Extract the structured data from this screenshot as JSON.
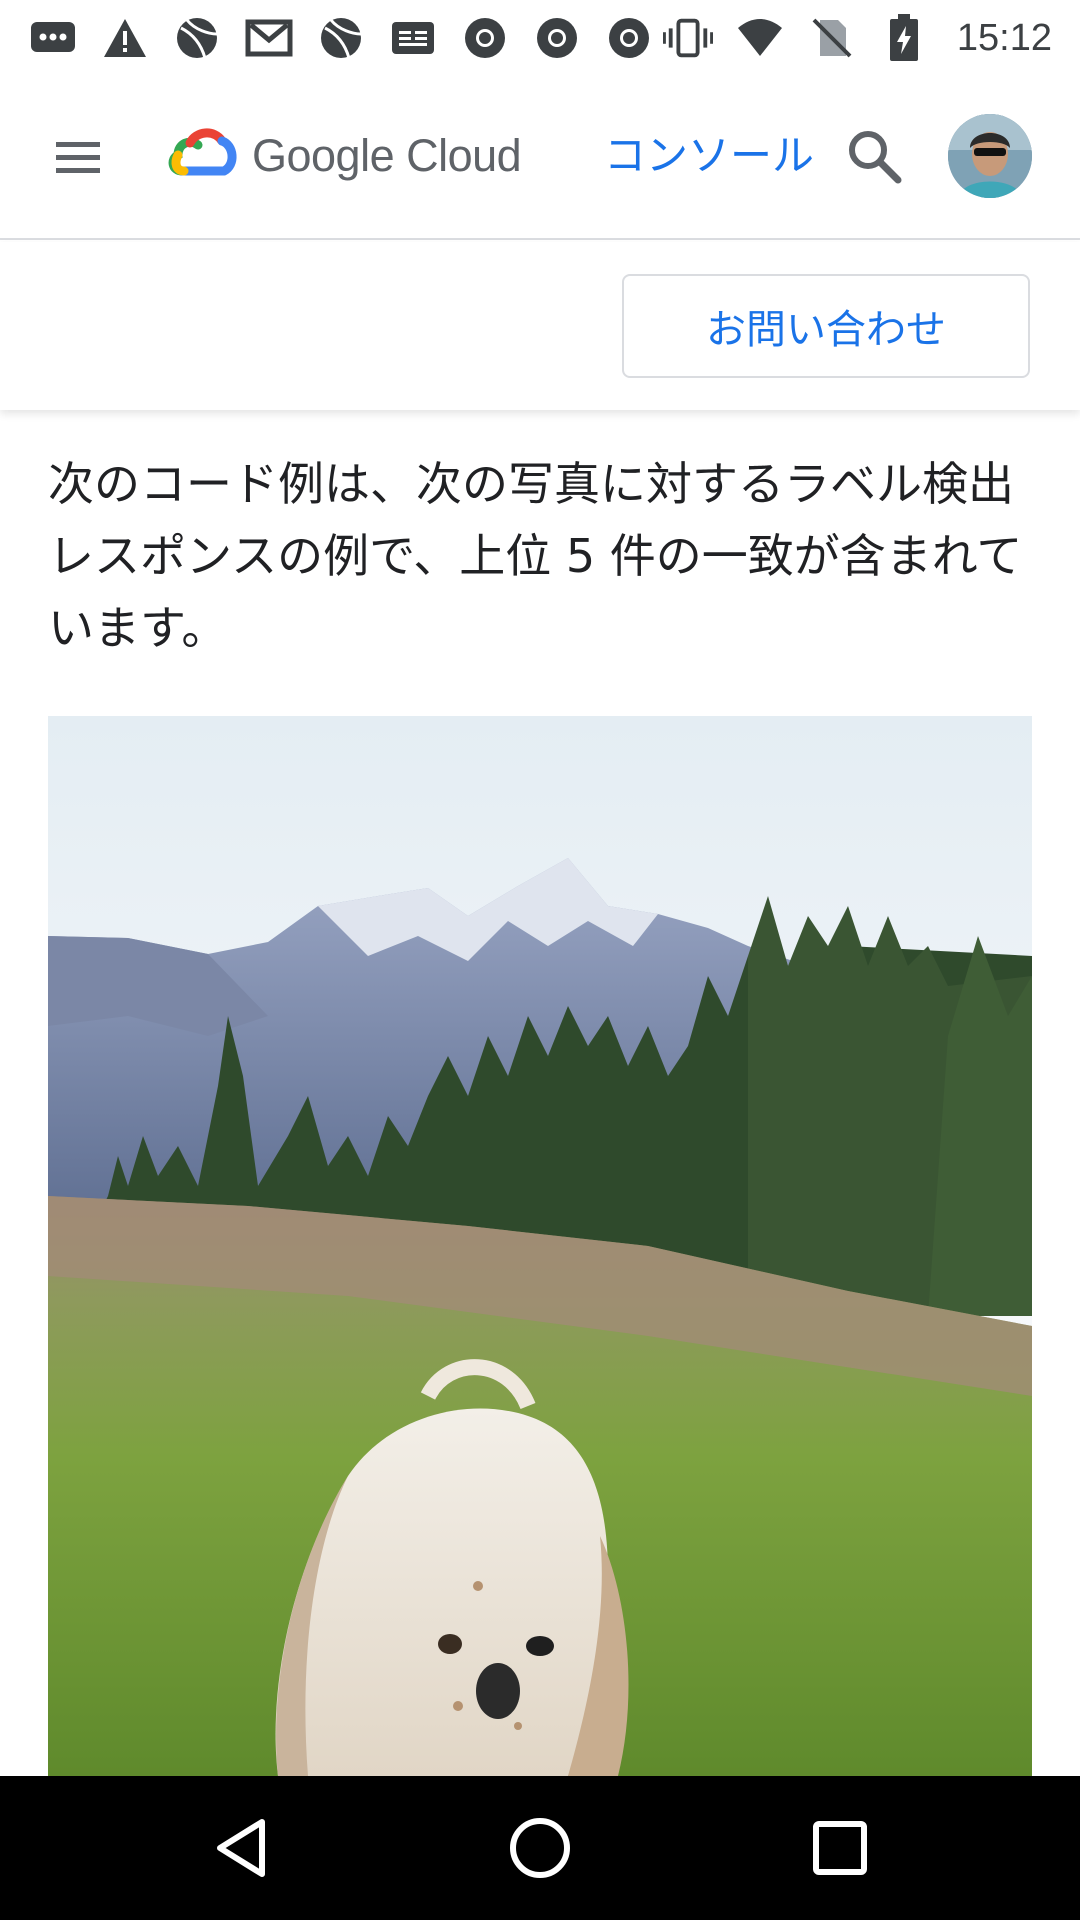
{
  "status_bar": {
    "time": "15:12",
    "left_icons": [
      "message-icon",
      "warning-icon",
      "basketball-icon",
      "gmail-icon",
      "basketball-icon",
      "news-icon",
      "chrome-icon",
      "chrome-icon",
      "chrome-icon"
    ],
    "right_icons": [
      "vibrate-icon",
      "wifi-icon",
      "no-sim-icon",
      "battery-charging-icon"
    ]
  },
  "header": {
    "brand": "Google Cloud",
    "console_label": "コンソール"
  },
  "subbar": {
    "contact_label": "お問い合わせ"
  },
  "content": {
    "description": "次のコード例は、次の写真に対するラベル検出レスポンスの例で、上位 5 件の一致が含まれています。"
  },
  "colors": {
    "link_blue": "#1a73e8",
    "text_dark": "#202124",
    "border": "#dadce0"
  }
}
